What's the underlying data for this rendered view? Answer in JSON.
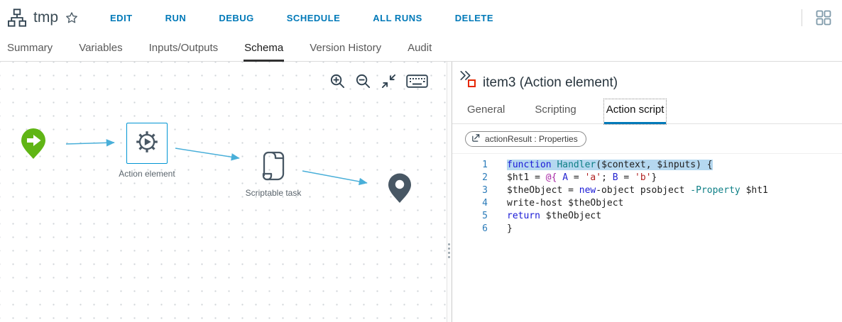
{
  "topbar": {
    "title": "tmp",
    "menu": [
      "EDIT",
      "RUN",
      "DEBUG",
      "SCHEDULE",
      "ALL RUNS",
      "DELETE"
    ]
  },
  "tabs": [
    "Summary",
    "Variables",
    "Inputs/Outputs",
    "Schema",
    "Version History",
    "Audit"
  ],
  "active_tab": "Schema",
  "canvas": {
    "node_labels": {
      "action": "Action element",
      "scriptable": "Scriptable task"
    }
  },
  "inspector": {
    "title": "item3 (Action element)",
    "tabs": [
      "General",
      "Scripting",
      "Action script"
    ],
    "active_tab": "Action script",
    "chip_label": "actionResult : Properties",
    "code_lines": [
      {
        "n": 1,
        "hl": true,
        "tokens": [
          {
            "c": "kw",
            "t": "function"
          },
          {
            "c": "pl",
            "t": " "
          },
          {
            "c": "fn",
            "t": "Handler"
          },
          {
            "c": "pl",
            "t": "($context, $inputs) {"
          }
        ]
      },
      {
        "n": 2,
        "hl": false,
        "tokens": [
          {
            "c": "pl",
            "t": "$ht1 = "
          },
          {
            "c": "br",
            "t": "@{"
          },
          {
            "c": "pl",
            "t": " "
          },
          {
            "c": "prop",
            "t": "A"
          },
          {
            "c": "pl",
            "t": " = "
          },
          {
            "c": "str",
            "t": "'a'"
          },
          {
            "c": "pl",
            "t": "; "
          },
          {
            "c": "prop",
            "t": "B"
          },
          {
            "c": "pl",
            "t": " = "
          },
          {
            "c": "str",
            "t": "'b'"
          },
          {
            "c": "pl",
            "t": "}"
          }
        ]
      },
      {
        "n": 3,
        "hl": false,
        "tokens": [
          {
            "c": "pl",
            "t": "$theObject = "
          },
          {
            "c": "kw",
            "t": "new"
          },
          {
            "c": "pl",
            "t": "-object psobject "
          },
          {
            "c": "fn",
            "t": "-Property"
          },
          {
            "c": "pl",
            "t": " $ht1"
          }
        ]
      },
      {
        "n": 4,
        "hl": false,
        "tokens": [
          {
            "c": "pl",
            "t": "write-host $theObject"
          }
        ]
      },
      {
        "n": 5,
        "hl": false,
        "tokens": [
          {
            "c": "kw",
            "t": "return"
          },
          {
            "c": "pl",
            "t": " $theObject"
          }
        ]
      },
      {
        "n": 6,
        "hl": false,
        "tokens": [
          {
            "c": "pl",
            "t": "}"
          }
        ]
      }
    ]
  },
  "colors": {
    "accent": "#0079b8",
    "tab-active-underline": "#313131",
    "canvas-node": "#485764",
    "start-green": "#60b515",
    "edge-blue": "#49afd9",
    "selection-blue": "#0095d3",
    "action-icon-red": "#e62700",
    "line-number": "#2b7bb9",
    "line-highlight": "#b5d8f0",
    "code-keyword": "#1a1ad6",
    "code-function": "#0e7f86",
    "code-string": "#b02020",
    "code-property": "#2525d0",
    "code-brace": "#a626a4"
  }
}
